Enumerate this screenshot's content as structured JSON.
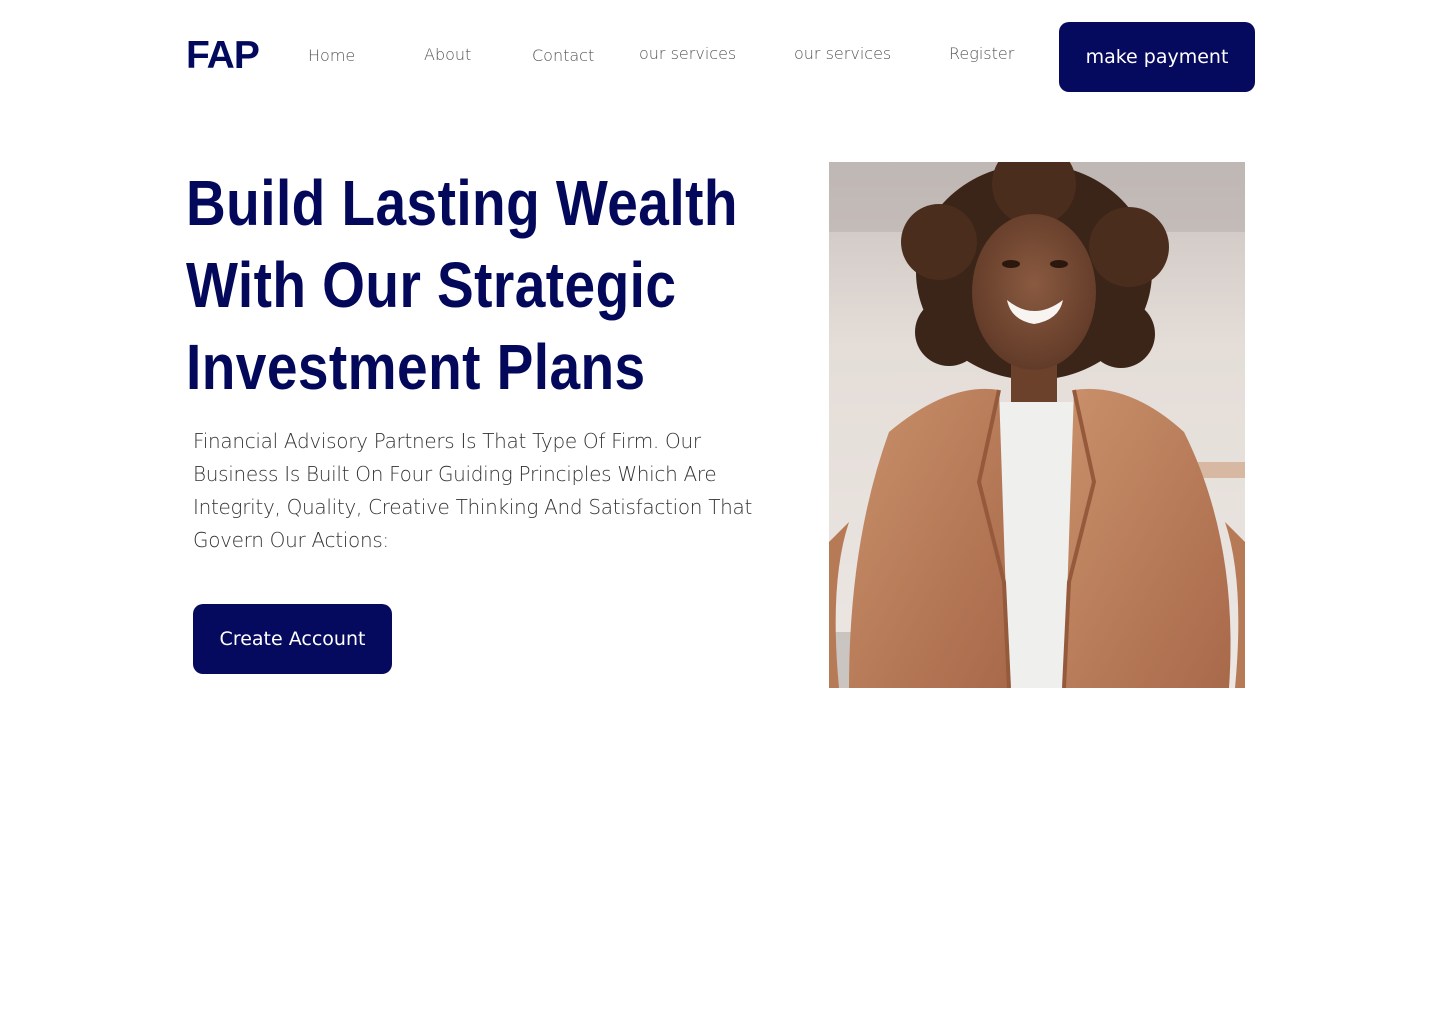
{
  "header": {
    "logo": "FAP",
    "nav": [
      {
        "label": "Home"
      },
      {
        "label": "About"
      },
      {
        "label": "Contact"
      },
      {
        "label": "our services"
      },
      {
        "label": "our services"
      },
      {
        "label": "Register"
      }
    ],
    "cta_label": "make payment"
  },
  "hero": {
    "title_lines": [
      "Build Lasting Wealth",
      "With Our Strategic",
      "Investment Plans"
    ],
    "description": "Financial Advisory Partners Is That Type Of Firm. Our Business Is Built On Four Guiding Principles Which Are Integrity, Quality, Creative Thinking And Satisfaction That Govern Our Actions:",
    "button_label": "Create Account"
  },
  "colors": {
    "brand_navy": "#050a5e",
    "nav_text": "#555555",
    "body_text": "#333333"
  }
}
